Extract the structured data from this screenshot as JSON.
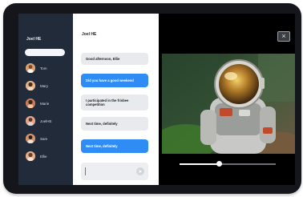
{
  "sidebar": {
    "user": "Joel HE",
    "search": {
      "value": "",
      "placeholder": ""
    },
    "contacts": [
      {
        "name": "Tom"
      },
      {
        "name": "Mary"
      },
      {
        "name": "Marie"
      },
      {
        "name": "JoelHE"
      },
      {
        "name": "Sam"
      },
      {
        "name": "Ellie"
      }
    ]
  },
  "chat": {
    "title": "Joel HE",
    "messages": [
      {
        "text": "Good afternoon, Ellie",
        "direction": "incoming"
      },
      {
        "text": "Did you have a good weekend",
        "direction": "outgoing"
      },
      {
        "text": "I participated in the frisbee competition",
        "direction": "incoming"
      },
      {
        "text": "Next time, definitely",
        "direction": "incoming"
      },
      {
        "text": "Next time, definitely",
        "direction": "outgoing"
      }
    ],
    "composer": {
      "value": "",
      "placeholder": ""
    }
  },
  "video": {
    "progress": 0.41
  },
  "colors": {
    "sidebar_bg": "#222b3a",
    "accent": "#2f8cf4",
    "incoming_bubble": "#e8eaee"
  },
  "icons": [
    "close-icon",
    "send-icon"
  ]
}
